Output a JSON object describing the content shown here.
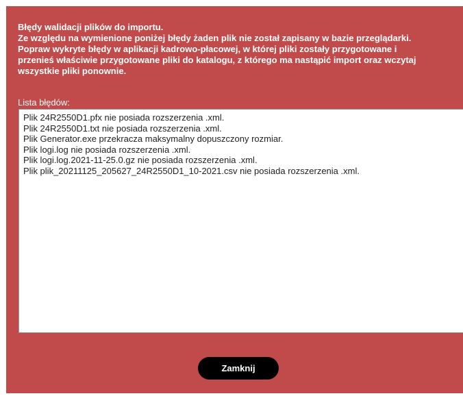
{
  "dialog": {
    "heading_lines": [
      "Błędy walidacji plików do importu.",
      "Ze względu na wymienione poniżej błędy żaden plik nie został zapisany w bazie przeglądarki.",
      "Popraw wykryte błędy w aplikacji kadrowo-płacowej, w której pliki zostały przygotowane i",
      "przenieś właściwie przygotowane pliki do katalogu, z którego ma nastąpić import oraz wczytaj",
      "wszystkie pliki ponownie."
    ],
    "list_label": "Lista błędów:",
    "errors": [
      "Plik 24R2550D1.pfx nie posiada rozszerzenia .xml.",
      "Plik 24R2550D1.txt nie posiada rozszerzenia .xml.",
      "Plik Generator.exe przekracza maksymalny dopuszczony rozmiar.",
      "Plik logi.log nie posiada rozszerzenia .xml.",
      "Plik logi.log.2021-11-25.0.gz nie posiada rozszerzenia .xml.",
      "Plik plik_20211125_205627_24R2550D1_10-2021.csv nie posiada rozszerzenia .xml."
    ],
    "close_label": "Zamknij"
  },
  "colors": {
    "dialog_background": "#c14a4a",
    "button_background": "#000000",
    "text_light": "#ffffff"
  }
}
